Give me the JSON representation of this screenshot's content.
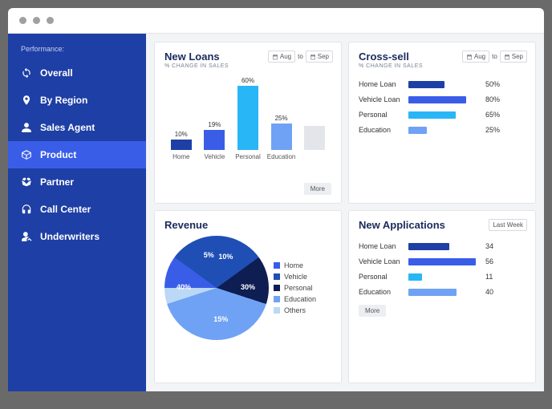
{
  "sidebar": {
    "header": "Performance:",
    "items": [
      {
        "label": "Overall"
      },
      {
        "label": "By Region"
      },
      {
        "label": "Sales Agent"
      },
      {
        "label": "Product"
      },
      {
        "label": "Partner"
      },
      {
        "label": "Call Center"
      },
      {
        "label": "Underwriters"
      }
    ]
  },
  "date_ctrl": {
    "from": "Aug",
    "to_word": "to",
    "to": "Sep"
  },
  "labels": {
    "more": "More",
    "last_week": "Last Week"
  },
  "colors": {
    "navy": "#1e3fa5",
    "royal": "#3a5de8",
    "cyan": "#29b6f6",
    "lightblue": "#6fa2f4",
    "pale": "#bcd8f7",
    "grey": "#e3e5ea"
  },
  "new_loans": {
    "title": "New Loans",
    "sub": "% CHANGE IN SALES"
  },
  "cross_sell": {
    "title": "Cross-sell",
    "sub": "% CHANGE IN SALES",
    "rows": [
      {
        "label": "Home Loan",
        "value": "50%"
      },
      {
        "label": "Vehicle Loan",
        "value": "80%"
      },
      {
        "label": "Personal",
        "value": "65%"
      },
      {
        "label": "Education",
        "value": "25%"
      }
    ]
  },
  "revenue": {
    "title": "Revenue",
    "legend": [
      "Home",
      "Vehicle",
      "Personal",
      "Education",
      "Others"
    ]
  },
  "new_apps": {
    "title": "New Applications",
    "rows": [
      {
        "label": "Home Loan",
        "value": "34"
      },
      {
        "label": "Vehicle Loan",
        "value": "56"
      },
      {
        "label": "Personal",
        "value": "11"
      },
      {
        "label": "Education",
        "value": "40"
      }
    ]
  },
  "chart_data": [
    {
      "id": "new_loans",
      "type": "bar",
      "title": "New Loans",
      "subtitle": "% CHANGE IN SALES",
      "categories": [
        "Home",
        "Vehicle",
        "Personal",
        "Education"
      ],
      "values": [
        10,
        19,
        60,
        25
      ],
      "colors": [
        "#1e3fa5",
        "#3a5de8",
        "#29b6f6",
        "#6fa2f4"
      ],
      "ylim": [
        0,
        60
      ],
      "ylabel": "% change"
    },
    {
      "id": "cross_sell",
      "type": "bar",
      "orientation": "horizontal",
      "title": "Cross-sell",
      "subtitle": "% CHANGE IN SALES",
      "categories": [
        "Home Loan",
        "Vehicle Loan",
        "Personal",
        "Education"
      ],
      "values": [
        50,
        80,
        65,
        25
      ],
      "colors": [
        "#1e3fa5",
        "#3a5de8",
        "#29b6f6",
        "#6fa2f4"
      ],
      "xlim": [
        0,
        100
      ]
    },
    {
      "id": "revenue",
      "type": "pie",
      "title": "Revenue",
      "categories": [
        "Home",
        "Vehicle",
        "Personal",
        "Education",
        "Others"
      ],
      "values": [
        10,
        30,
        15,
        40,
        5
      ],
      "colors": [
        "#3a5de8",
        "#1f4fb5",
        "#0e1d52",
        "#6fa2f4",
        "#bcd8f7"
      ]
    },
    {
      "id": "new_applications",
      "type": "bar",
      "orientation": "horizontal",
      "title": "New Applications",
      "period": "Last Week",
      "categories": [
        "Home Loan",
        "Vehicle Loan",
        "Personal",
        "Education"
      ],
      "values": [
        34,
        56,
        11,
        40
      ],
      "colors": [
        "#1e3fa5",
        "#3a5de8",
        "#29b6f6",
        "#6fa2f4"
      ],
      "xlim": [
        0,
        60
      ]
    }
  ]
}
